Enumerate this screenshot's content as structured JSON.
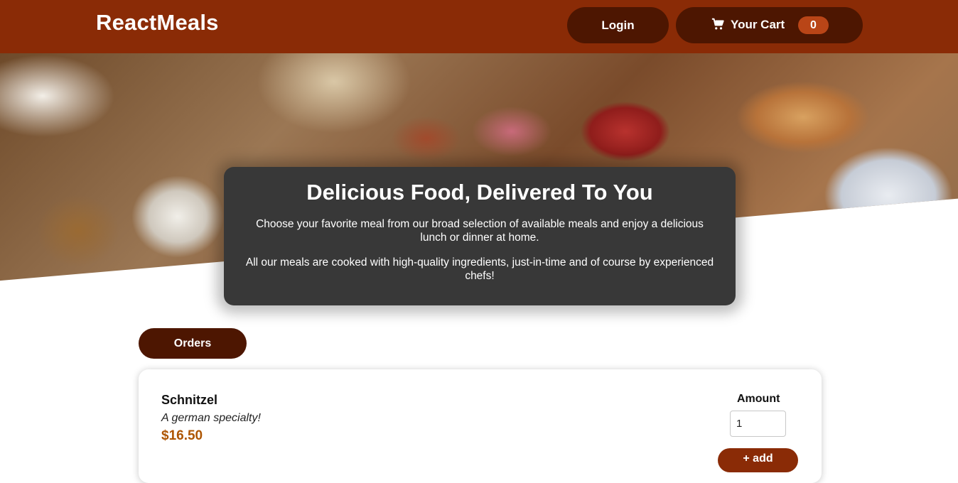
{
  "header": {
    "brand": "ReactMeals",
    "login_label": "Login",
    "cart_label": "Your Cart",
    "cart_count": "0",
    "cart_icon": "cart-icon"
  },
  "summary": {
    "title": "Delicious Food, Delivered To You",
    "paragraph1": "Choose your favorite meal from our broad selection of available meals and enjoy a delicious lunch or dinner at home.",
    "paragraph2": "All our meals are cooked with high-quality ingredients, just-in-time and of course by experienced chefs!"
  },
  "orders_label": "Orders",
  "meals": [
    {
      "name": "Schnitzel",
      "description": "A german specialty!",
      "price": "$16.50",
      "amount_label": "Amount",
      "amount_value": "1",
      "add_label": "+ add"
    }
  ],
  "colors": {
    "header_bg": "#8a2b06",
    "button_dark": "#4d1601",
    "badge": "#b94517",
    "summary_bg": "#383838",
    "price": "#ad5502"
  }
}
